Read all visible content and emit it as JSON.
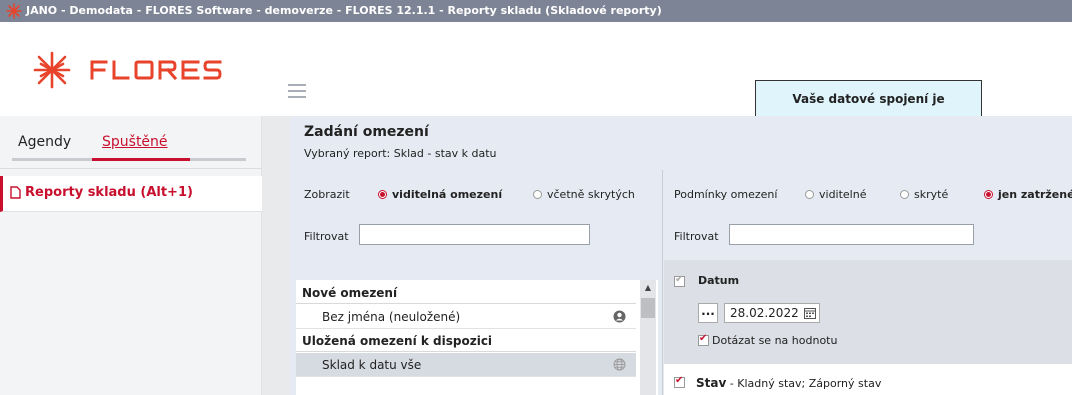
{
  "window": {
    "title": "JANO - Demodata - FLORES Software - demoverze - FLORES 12.1.1 - Reporty skladu  (Skladové reporty)"
  },
  "header": {
    "logo_text": "FLORES",
    "connection_notice": "Vaše datové spojení je Demodata"
  },
  "sidebar": {
    "tabs": [
      {
        "label": "Agendy",
        "active": false
      },
      {
        "label": "Spuštěné",
        "active": true
      }
    ],
    "items": [
      {
        "label": "Reporty skladu (Alt+1)",
        "icon": "document-icon"
      }
    ]
  },
  "main": {
    "title": "Zadání omezení",
    "subtitle": "Vybraný report: Sklad - stav k datu",
    "left": {
      "show_label": "Zobrazit",
      "show_options": [
        {
          "label": "viditelná omezení",
          "selected": true
        },
        {
          "label": "včetně skrytých",
          "selected": false
        }
      ],
      "filter_label": "Filtrovat",
      "filter_value": "",
      "groups": [
        {
          "header": "Nové omezení",
          "rows": [
            {
              "label": "Bez jména (neuložené)",
              "icon": "user-icon",
              "selected": false
            }
          ]
        },
        {
          "header": "Uložená omezení k dispozici",
          "rows": [
            {
              "label": "Sklad k datu vše",
              "icon": "globe-icon",
              "selected": true
            }
          ]
        }
      ]
    },
    "right": {
      "conditions_label": "Podmínky omezení",
      "condition_options": [
        {
          "label": "viditelné",
          "selected": false
        },
        {
          "label": "skryté",
          "selected": false
        },
        {
          "label": "jen zatržené",
          "selected": true
        }
      ],
      "filter_label": "Filtrovat",
      "filter_value": "",
      "datum": {
        "label": "Datum",
        "checked": true,
        "dots_button": "...",
        "date_value": "28.02.2022",
        "ask_label": "Dotázat se na hodnotu",
        "ask_checked": true
      },
      "stav": {
        "label": "Stav",
        "description": " - Kladný stav; Záporný stav",
        "checked": true
      }
    }
  },
  "colors": {
    "accent": "#c8102e",
    "titlebar": "#7d8495",
    "notice_bg": "#dff4fb",
    "content_bg": "#e6ebf3"
  }
}
